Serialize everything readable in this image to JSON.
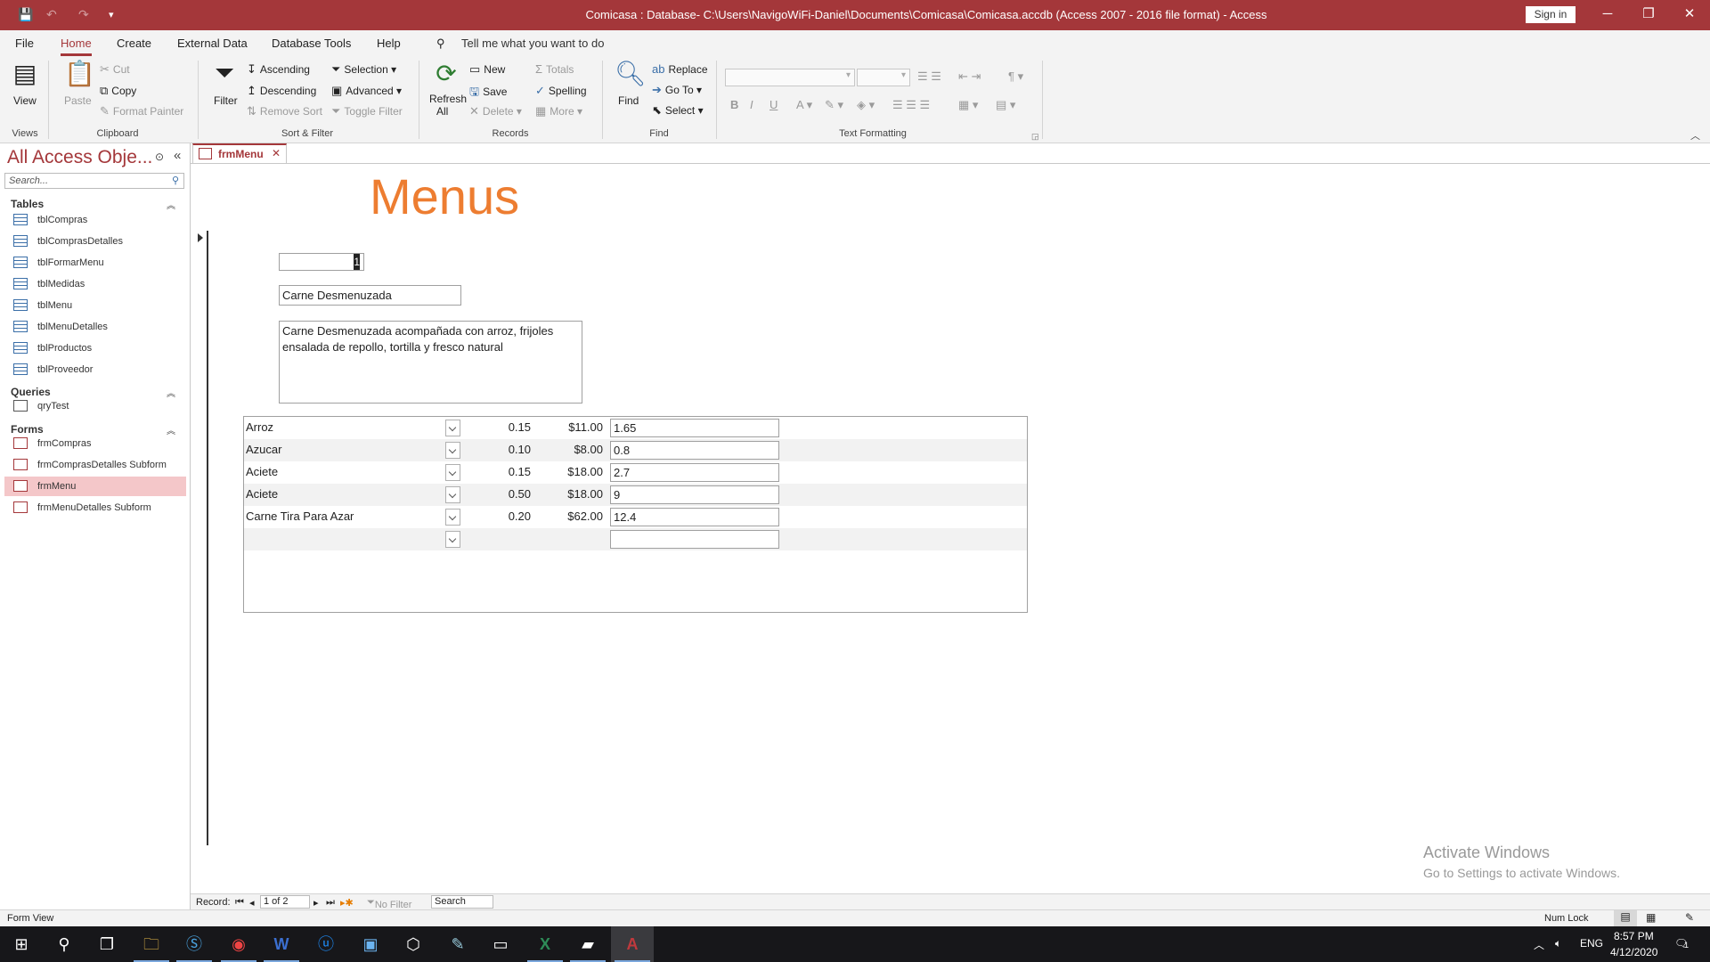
{
  "window": {
    "title": "Comicasa : Database- C:\\Users\\NavigoWiFi-Daniel\\Documents\\Comicasa\\Comicasa.accdb (Access 2007 - 2016 file format)  -  Access",
    "sign_in": "Sign in",
    "minimize": "─",
    "restore": "❐",
    "close": "✕"
  },
  "menu_tabs": [
    "File",
    "Home",
    "Create",
    "External Data",
    "Database Tools",
    "Help"
  ],
  "tell_me": "Tell me what you want to do",
  "ribbon": {
    "views": {
      "view": "View",
      "group": "Views"
    },
    "clipboard": {
      "paste": "Paste",
      "cut": "Cut",
      "copy": "Copy",
      "format_painter": "Format Painter",
      "group": "Clipboard"
    },
    "sort_filter": {
      "filter": "Filter",
      "ascending": "Ascending",
      "descending": "Descending",
      "remove_sort": "Remove Sort",
      "selection": "Selection",
      "advanced": "Advanced",
      "toggle_filter": "Toggle Filter",
      "group": "Sort & Filter"
    },
    "records": {
      "refresh": "Refresh",
      "refresh_sub": "All",
      "new": "New",
      "save": "Save",
      "delete": "Delete",
      "totals": "Totals",
      "spelling": "Spelling",
      "more": "More",
      "group": "Records"
    },
    "find": {
      "find": "Find",
      "replace": "Replace",
      "goto": "Go To",
      "select": "Select",
      "group": "Find"
    },
    "text_formatting": {
      "bold": "B",
      "italic": "I",
      "underline": "U",
      "group": "Text Formatting"
    }
  },
  "nav": {
    "title": "All Access Obje...",
    "search_placeholder": "Search...",
    "groups": [
      {
        "name": "Tables",
        "items": [
          "tblCompras",
          "tblComprasDetalles",
          "tblFormarMenu",
          "tblMedidas",
          "tblMenu",
          "tblMenuDetalles",
          "tblProductos",
          "tblProveedor"
        ]
      },
      {
        "name": "Queries",
        "items": [
          "qryTest"
        ]
      },
      {
        "name": "Forms",
        "items": [
          "frmCompras",
          "frmComprasDetalles Subform",
          "frmMenu",
          "frmMenuDetalles Subform"
        ]
      }
    ],
    "selected": "frmMenu"
  },
  "doc_tab": {
    "label": "frmMenu"
  },
  "form": {
    "title": "Menus",
    "id_value": "1",
    "name_value": "Carne Desmenuzada",
    "description": "Carne Desmenuzada acompañada con arroz, frijoles\nensalada de repollo, tortilla y fresco natural",
    "subform_rows": [
      {
        "product": "Arroz",
        "qty": "0.15",
        "price": "$11.00",
        "total": "1.65"
      },
      {
        "product": "Azucar",
        "qty": "0.10",
        "price": "$8.00",
        "total": "0.8"
      },
      {
        "product": "Aciete",
        "qty": "0.15",
        "price": "$18.00",
        "total": "2.7"
      },
      {
        "product": "Aciete",
        "qty": "0.50",
        "price": "$18.00",
        "total": "9"
      },
      {
        "product": "Carne Tira Para Azar",
        "qty": "0.20",
        "price": "$62.00",
        "total": "12.4"
      },
      {
        "product": "",
        "qty": "",
        "price": "",
        "total": ""
      }
    ]
  },
  "record_nav": {
    "label": "Record:",
    "position": "1 of 2",
    "filter": "No Filter",
    "search": "Search"
  },
  "watermark": {
    "line1": "Activate Windows",
    "line2": "Go to Settings to activate Windows."
  },
  "status": {
    "left": "Form View",
    "num_lock": "Num Lock"
  },
  "taskbar": {
    "lang": "ENG",
    "time": "8:57 PM",
    "date": "4/12/2020",
    "notifications": "1"
  }
}
